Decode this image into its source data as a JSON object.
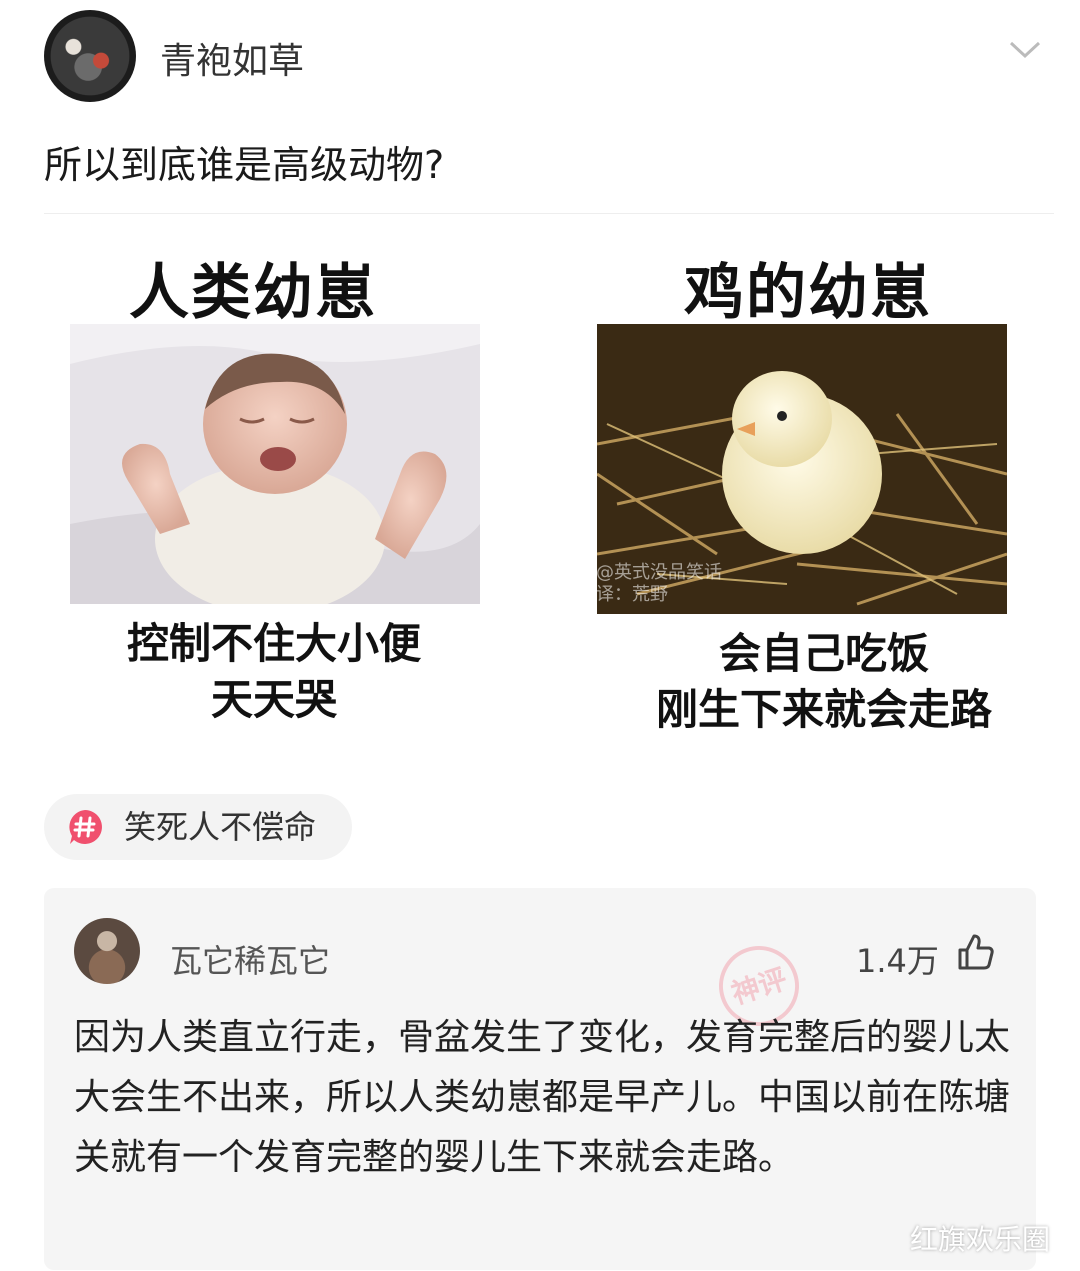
{
  "post": {
    "username": "青袍如草",
    "text": "所以到底谁是高级动物?"
  },
  "meme": {
    "left_title": "人类幼崽",
    "right_title": "鸡的幼崽",
    "left_caption_1": "控制不住大小便",
    "left_caption_2": "天天哭",
    "right_caption_1": "会自己吃饭",
    "right_caption_2": "刚生下来就会走路",
    "watermark_1": "@英式没品笑话",
    "watermark_2": "译：荒野"
  },
  "tag": {
    "label": "笑死人不偿命",
    "icon": "hash-topic-icon",
    "icon_color": "#f0506e"
  },
  "comment": {
    "username": "瓦它稀瓦它",
    "likes": "1.4万",
    "stamp": "神评",
    "body": "因为人类直立行走，骨盆发生了变化，发育完整后的婴儿太大会生不出来，所以人类幼崽都是早产儿。中国以前在陈塘关就有一个发育完整的婴儿生下来就会走路。"
  },
  "site_watermark": "红旗欢乐圈"
}
